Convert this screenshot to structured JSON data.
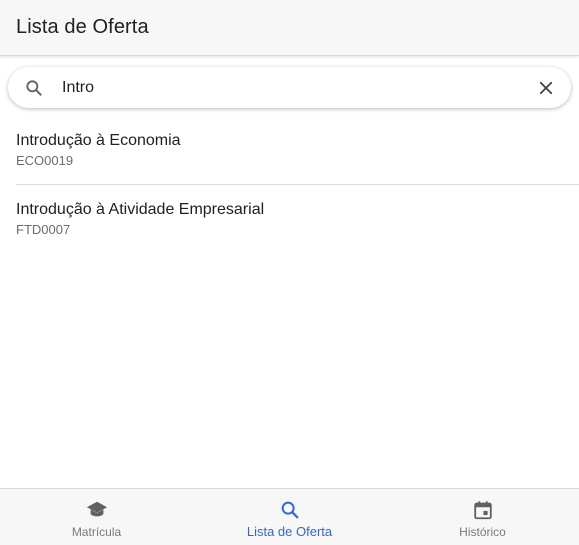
{
  "toolbar": {
    "title": "Lista de Oferta"
  },
  "search": {
    "value": "Intro",
    "placeholder": "",
    "search_icon": "search-icon",
    "clear_icon": "close-icon"
  },
  "results": [
    {
      "title": "Introdução à Economia",
      "code": "ECO0019"
    },
    {
      "title": "Introdução à Atividade Empresarial",
      "code": "FTD0007"
    }
  ],
  "tabs": [
    {
      "label": "Matrícula",
      "icon": "school-icon",
      "active": false
    },
    {
      "label": "Lista de Oferta",
      "icon": "search-icon",
      "active": true
    },
    {
      "label": "Histórico",
      "icon": "calendar-icon",
      "active": false
    }
  ],
  "colors": {
    "accent": "#3367d6",
    "icon_gray": "#616161",
    "bar_bg": "#f7f7f7"
  }
}
